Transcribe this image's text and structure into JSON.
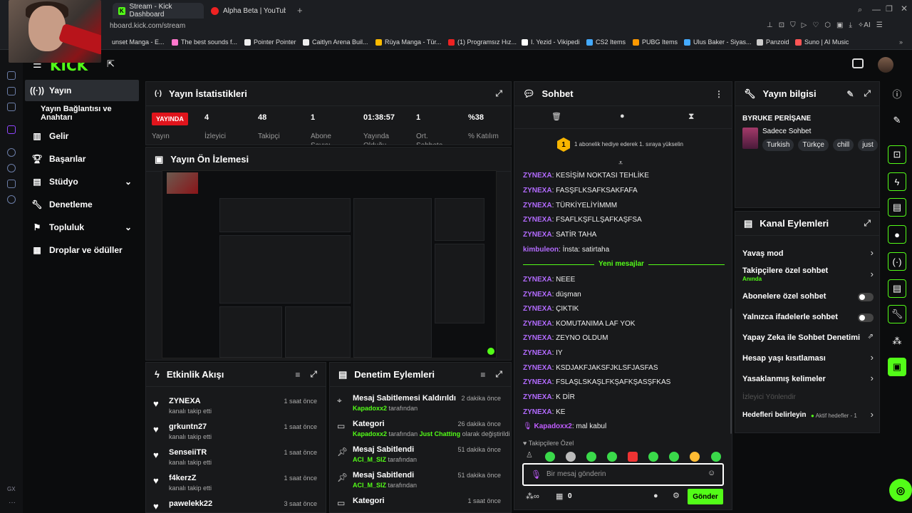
{
  "browser": {
    "tabs": [
      {
        "label": "Stream - Kick Dashboard",
        "active": true
      },
      {
        "label": "Alpha Beta | YouTube",
        "active": false
      }
    ],
    "url": "hboard.kick.com/stream",
    "bookmarks": [
      "unset Manga - E...",
      "The best sounds f...",
      "Pointer Pointer",
      "Caitlyn Arena Buil...",
      "Rüya Manga - Tür...",
      "(1) Programsız Hız...",
      "I. Yezid - Vikipedi",
      "CS2 Items",
      "PUBG Items",
      "Ulus Baker - Siyas...",
      "Panzoid",
      "Suno | AI Music"
    ]
  },
  "logo": "KICK",
  "nav": {
    "items": [
      {
        "label": "Yayın",
        "active": true
      },
      {
        "label": "Yayın Bağlantısı ve Anahtarı"
      },
      {
        "label": "Gelir"
      },
      {
        "label": "Başarılar"
      },
      {
        "label": "Stüdyo"
      },
      {
        "label": "Denetleme"
      },
      {
        "label": "Topluluk"
      },
      {
        "label": "Droplar ve ödüller"
      }
    ]
  },
  "stats": {
    "title": "Yayın İstatistikleri",
    "live": "YAYINDA",
    "live_label": "Yayın",
    "items": [
      {
        "value": "4",
        "label": "İzleyici"
      },
      {
        "value": "48",
        "label": "Takipçi"
      },
      {
        "value": "1",
        "label": "Abone Sayısı"
      },
      {
        "value": "01:38:57",
        "label": "Yayında Olduğu"
      },
      {
        "value": "1",
        "label": "Ort. Sohbete"
      },
      {
        "value": "%38",
        "label": "% Katılım"
      }
    ]
  },
  "preview": {
    "title": "Yayın Ön İzlemesi"
  },
  "activity": {
    "title": "Etkinlik Akışı",
    "items": [
      {
        "name": "ZYNEXA",
        "sub": "kanalı takip etti",
        "time": "1 saat önce"
      },
      {
        "name": "grkuntn27",
        "sub": "kanalı takip etti",
        "time": "1 saat önce"
      },
      {
        "name": "SenseiiTR",
        "sub": "kanalı takip etti",
        "time": "1 saat önce"
      },
      {
        "name": "f4kerzZ",
        "sub": "kanalı takip etti",
        "time": "1 saat önce"
      },
      {
        "name": "pawelekk22",
        "sub": "",
        "time": "3 saat önce"
      }
    ]
  },
  "moderation": {
    "title": "Denetim Eylemleri",
    "items": [
      {
        "title": "Mesaj Sabitlemesi Kaldırıldı",
        "user": "Kapadoxx2",
        "tail": "tarafından",
        "time": "2 dakika önce"
      },
      {
        "title": "Kategori",
        "user": "Kapadoxx2",
        "tail": "tarafından",
        "cat": "Just Chatting",
        "tail2": "olarak değiştirildi",
        "time": "26 dakika önce"
      },
      {
        "title": "Mesaj Sabitlendi",
        "user": "ACI_M_SIZ",
        "tail": "tarafından",
        "time": "51 dakika önce"
      },
      {
        "title": "Mesaj Sabitlendi",
        "user": "ACI_M_SIZ",
        "tail": "tarafından",
        "time": "51 dakika önce"
      },
      {
        "title": "Kategori",
        "user": "",
        "tail": "",
        "time": "1 saat önce"
      }
    ]
  },
  "chat": {
    "title": "Sohbet",
    "gift_badge": "1",
    "gift_text": "1 abonelik hediye ederek 1. sıraya yükselin",
    "messages_before": [
      {
        "user": "ZYNEXA",
        "text": "KESİŞİM NOKTASI TEHLİKE"
      },
      {
        "user": "ZYNEXA",
        "text": "FASŞFLKSAFKSAKFAFA"
      },
      {
        "user": "ZYNEXA",
        "text": "TÜRKİYELİYİMMM"
      },
      {
        "user": "ZYNEXA",
        "text": "FSAFLKŞFLLŞAFKAŞFSA"
      },
      {
        "user": "ZYNEXA",
        "text": "SATİR TAHA"
      },
      {
        "user": "kimbuleon",
        "text": "İnsta: satirtaha"
      }
    ],
    "new_messages": "Yeni mesajlar",
    "messages_after": [
      {
        "user": "ZYNEXA",
        "text": "NEEE"
      },
      {
        "user": "ZYNEXA",
        "text": "düşman"
      },
      {
        "user": "ZYNEXA",
        "text": "ÇIKTIK"
      },
      {
        "user": "ZYNEXA",
        "text": "KOMUTANIMA LAF YOK"
      },
      {
        "user": "ZYNEXA",
        "text": "ZEYNO OLDUM"
      },
      {
        "user": "ZYNEXA",
        "text": "IY"
      },
      {
        "user": "ZYNEXA",
        "text": "KSDJAKFJAKSFJKLSFJASFAS"
      },
      {
        "user": "ZYNEXA",
        "text": "FSLAŞLSKAŞLFKŞAFKŞASŞFKAS"
      },
      {
        "user": "ZYNEXA",
        "text": "K DİR"
      },
      {
        "user": "ZYNEXA",
        "text": "KE"
      }
    ],
    "last": {
      "user": "Kapadoxx2",
      "text": "mal kabul"
    },
    "followers_only": "Takipçilere Özel",
    "input_placeholder": "Bir mesaj gönderin",
    "points": "0",
    "send": "Gönder"
  },
  "info": {
    "title": "Yayın bilgisi",
    "stream_title": "BYRUKE PERİŞANE",
    "category": "Sadece Sohbet",
    "tags": [
      "Turkish",
      "Türkçe",
      "chill",
      "just"
    ]
  },
  "channel": {
    "title": "Kanal Eylemleri",
    "rows": [
      {
        "label": "Yavaş mod",
        "kind": "arrow"
      },
      {
        "label": "Takipçilere özel sohbet",
        "sub": "Anında",
        "kind": "arrow"
      },
      {
        "label": "Abonelere özel sohbet",
        "kind": "toggle"
      },
      {
        "label": "Yalnızca ifadelerle sohbet",
        "kind": "toggle"
      },
      {
        "label": "Yapay Zeka ile Sohbet Denetimi",
        "kind": "ext"
      },
      {
        "label": "Hesap yaşı kısıtlaması",
        "kind": "arrow"
      },
      {
        "label": "Yasaklanmış kelimeler",
        "kind": "arrow"
      },
      {
        "label": "İzleyici Yönlendir",
        "kind": "disabled"
      },
      {
        "label": "Hedefleri belirleyin",
        "kind": "arrow",
        "extra": "Aktif hedefler - 1"
      }
    ]
  },
  "colors": {
    "accent": "#53fc18",
    "live": "#e0141c",
    "username": "#b36bff"
  }
}
